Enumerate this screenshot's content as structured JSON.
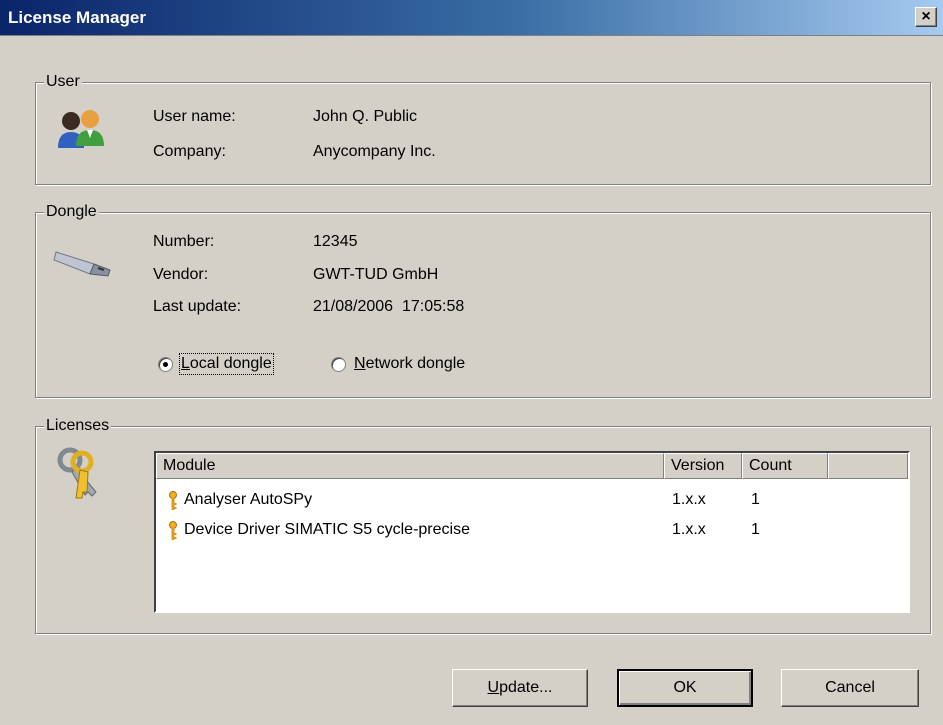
{
  "window": {
    "title": "License Manager",
    "close_label": "×"
  },
  "user": {
    "legend": "User",
    "name_label": "User name:",
    "name_value": "John Q. Public",
    "company_label": "Company:",
    "company_value": "Anycompany Inc.",
    "icon": "users-icon"
  },
  "dongle": {
    "legend": "Dongle",
    "number_label": "Number:",
    "number_value": "12345",
    "vendor_label": "Vendor:",
    "vendor_value": "GWT-TUD GmbH",
    "update_label": "Last update:",
    "update_value": "21/08/2006  17:05:58",
    "icon": "usb-dongle-icon",
    "local_first": "L",
    "local_rest": "ocal dongle",
    "network_first": "N",
    "network_rest": "etwork dongle",
    "selected": "local"
  },
  "licenses": {
    "legend": "Licenses",
    "icon": "keys-icon",
    "columns": [
      "Module",
      "Version",
      "Count"
    ],
    "rows": [
      {
        "module": "Analyser AutoSPy",
        "version": "1.x.x",
        "count": "1"
      },
      {
        "module": "Device Driver SIMATIC S5 cycle-precise",
        "version": "1.x.x",
        "count": "1"
      }
    ]
  },
  "buttons": {
    "update_first": "U",
    "update_rest": "pdate...",
    "ok": "OK",
    "cancel": "Cancel"
  }
}
